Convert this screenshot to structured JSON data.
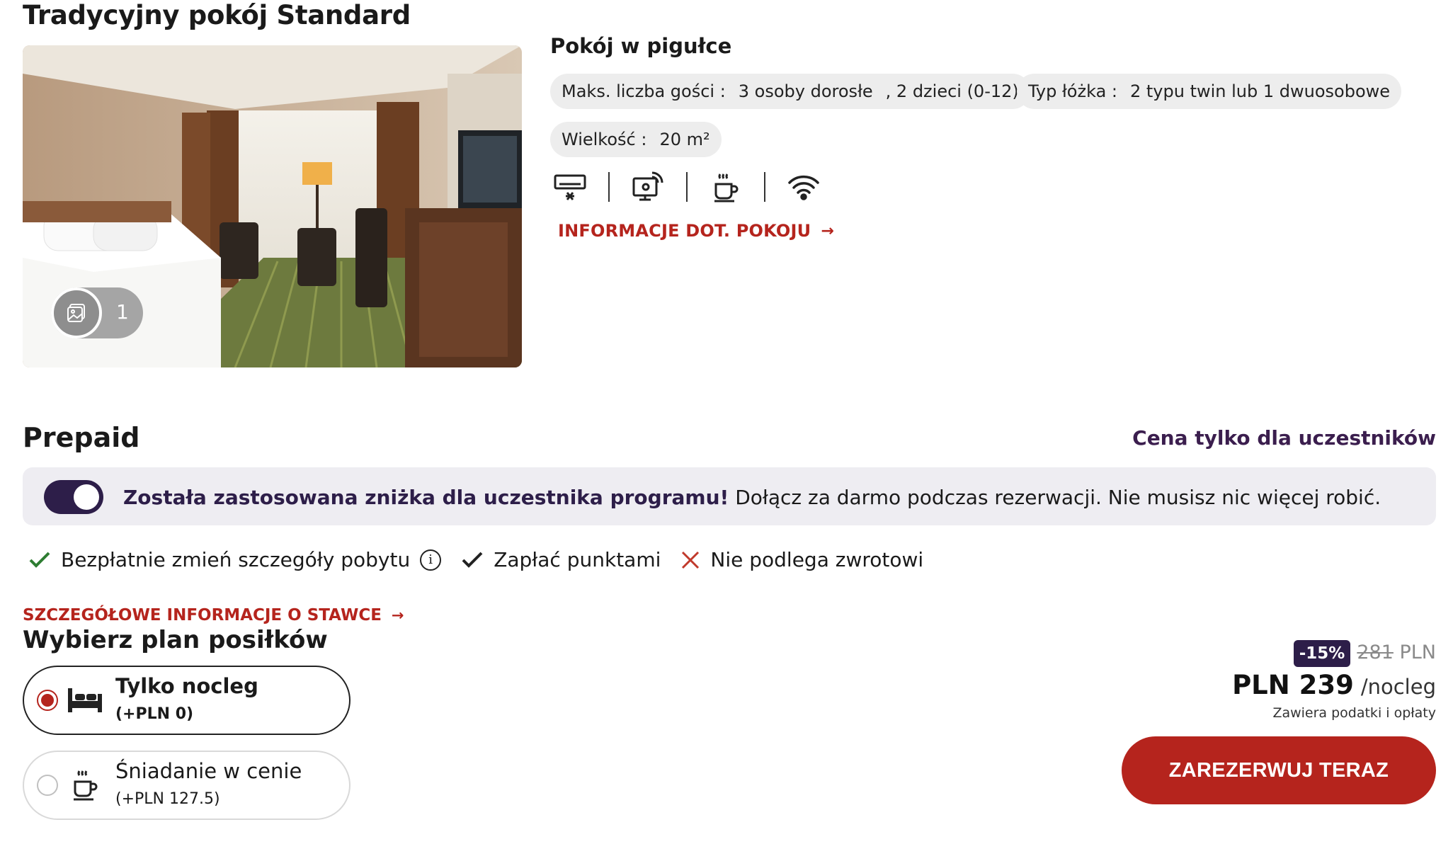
{
  "room": {
    "title": "Tradycyjny pokój Standard",
    "gallery_count": "1",
    "glance_title": "Pokój w pigułce",
    "guests": {
      "label": "Maks. liczba gości :",
      "adults": "3 osoby dorosłe",
      "children": ", 2 dzieci (0-12)"
    },
    "bed": {
      "label": "Typ łóżka :",
      "value": "2 typu twin lub 1 dwuosobowe"
    },
    "size": {
      "label": "Wielkość :",
      "value": "20 m²"
    },
    "amenities": [
      "air-conditioning-icon",
      "satellite-tv-icon",
      "coffee-maker-icon",
      "wifi-icon"
    ],
    "info_link": "INFORMACJE DOT. POKOJU"
  },
  "rate": {
    "title": "Prepaid",
    "member_price_label": "Cena tylko dla uczestników",
    "banner": {
      "toggle_on": true,
      "strong": "Została zastosowana zniżka dla uczestnika programu!",
      "text": " Dołącz za darmo podczas rezerwacji. Nie musisz nic więcej robić."
    },
    "benefits": [
      {
        "icon": "check-icon",
        "label": "Bezpłatnie zmień szczegóły pobytu",
        "info": "i"
      },
      {
        "icon": "check-icon",
        "label": "Zapłać punktami"
      },
      {
        "icon": "cross-icon",
        "label": "Nie podlega zwrotowi"
      }
    ],
    "details_link": "SZCZEGÓŁOWE INFORMACJE O STAWCE",
    "meal_title": "Wybierz plan posiłków",
    "meal_options": [
      {
        "name": "Tylko nocleg",
        "price": "(+PLN 0)",
        "icon": "bed-icon",
        "selected": true
      },
      {
        "name": "Śniadanie w cenie",
        "price": "(+PLN 127.5)",
        "icon": "coffee-cup-icon",
        "selected": false
      }
    ]
  },
  "price": {
    "discount": "-15%",
    "old_price": "281",
    "old_currency": " PLN",
    "current": "PLN 239",
    "unit": "/nocleg",
    "tax_note": "Zawiera podatki i opłaty",
    "book_label": "ZAREZERWUJ TERAZ"
  },
  "colors": {
    "accent_red": "#b5241d",
    "brand_purple": "#2d1e49",
    "chip_bg": "#ededed",
    "banner_bg": "#eeedf2",
    "check_green": "#2e7d32"
  }
}
